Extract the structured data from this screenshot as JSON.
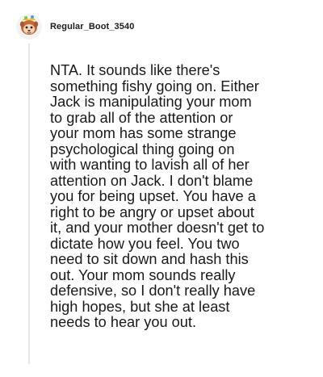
{
  "comment": {
    "username": "Regular_Boot_3540",
    "avatar_icon": "reddit-snoo-avatar-icon",
    "body": "NTA. It sounds like there's\nsomething fishy going on. Either\nJack is manipulating your mom\nto grab all of the attention or\nyour mom has some strange\npsychological thing going on\nwith wanting to lavish all of her\nattention on Jack. I don't blame\nyou for being upset. You have a\nright to be angry or upset about\nit, and your mother doesn't get to\ndictate how you feel. You two\nneed to sit down and hash this\nout. Your mom sounds really\ndefensive, so I don't really have\nhigh hopes, but she at least\nneeds to hear you out."
  },
  "colors": {
    "background": "#ffffff",
    "text": "#1a1a1b",
    "thread_line": "#e6e6e6"
  }
}
